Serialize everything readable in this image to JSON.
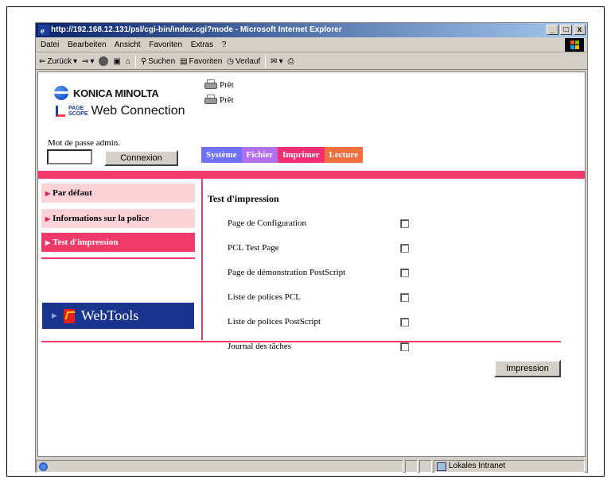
{
  "window": {
    "title": "http://192.168.12.131/psl/cgi-bin/index.cgi?mode - Microsoft Internet Explorer",
    "min": "_",
    "max": "×",
    "restore": "□",
    "close": "x"
  },
  "menubar": {
    "items": [
      "Datei",
      "Bearbeiten",
      "Ansicht",
      "Favoriten",
      "Extras",
      "?"
    ]
  },
  "toolbar": {
    "back": "Zurück",
    "search": "Suchen",
    "favorites": "Favoriten",
    "history": "Verlauf"
  },
  "header": {
    "brand": "KONICA MINOLTA",
    "product_small": "PAGE\nSCOPE",
    "product": "Web Connection",
    "status_1": "Prêt",
    "status_2": "Prêt"
  },
  "login": {
    "label": "Mot de passe admin.",
    "value": "",
    "button": "Connexion"
  },
  "tabs": [
    "Système",
    "Fichier",
    "Imprimer",
    "Lecture"
  ],
  "sidebar": {
    "items": [
      {
        "label": "Par défaut",
        "active": false
      },
      {
        "label": "Informations sur la police",
        "active": false
      },
      {
        "label": "Test d'impression",
        "active": true
      }
    ],
    "webtools": "WebTools"
  },
  "main": {
    "title": "Test d'impression",
    "options": [
      {
        "label": "Page de Configuration",
        "checked": false
      },
      {
        "label": "PCL Test Page",
        "checked": false
      },
      {
        "label": "Page de démonstration PostScript",
        "checked": false
      },
      {
        "label": "Liste de polices PCL",
        "checked": false
      },
      {
        "label": "Liste de polices PostScript",
        "checked": false
      },
      {
        "label": "Journal des tâches",
        "checked": false
      }
    ],
    "print_button": "Impression"
  },
  "statusbar": {
    "zone": "Lokales Intranet"
  },
  "colors": {
    "accent": "#f03b6a",
    "sidebar_bg": "#fbd2d8",
    "tab_systeme": "#7070ff",
    "tab_fichier": "#b070f0",
    "tab_imprimer": "#f03070",
    "tab_lecture": "#f07040",
    "webtools_bg": "#1a3590"
  }
}
